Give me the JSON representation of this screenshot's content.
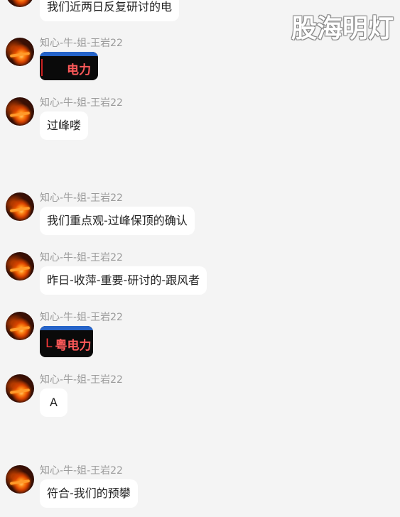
{
  "watermark": "股海明灯",
  "messages": [
    {
      "type": "text",
      "sender": "",
      "text": "我们近两日反复研讨的电"
    },
    {
      "type": "image",
      "sender": "知心-牛-姐-王岩22",
      "prefix": "",
      "label": "电力"
    },
    {
      "type": "text",
      "sender": "知心-牛-姐-王岩22",
      "text": "过峰喽"
    },
    {
      "type": "text",
      "sender": "知心-牛-姐-王岩22",
      "text": "我们重点观-过峰保顶的确认"
    },
    {
      "type": "text",
      "sender": "知心-牛-姐-王岩22",
      "text": "昨日-收萍-重要-研讨的-跟风者"
    },
    {
      "type": "image",
      "sender": "知心-牛-姐-王岩22",
      "prefix": "L",
      "label": "粤电力"
    },
    {
      "type": "text",
      "sender": "知心-牛-姐-王岩22",
      "text": "A"
    },
    {
      "type": "text",
      "sender": "知心-牛-姐-王岩22",
      "text": "符合-我们的预攀"
    }
  ]
}
